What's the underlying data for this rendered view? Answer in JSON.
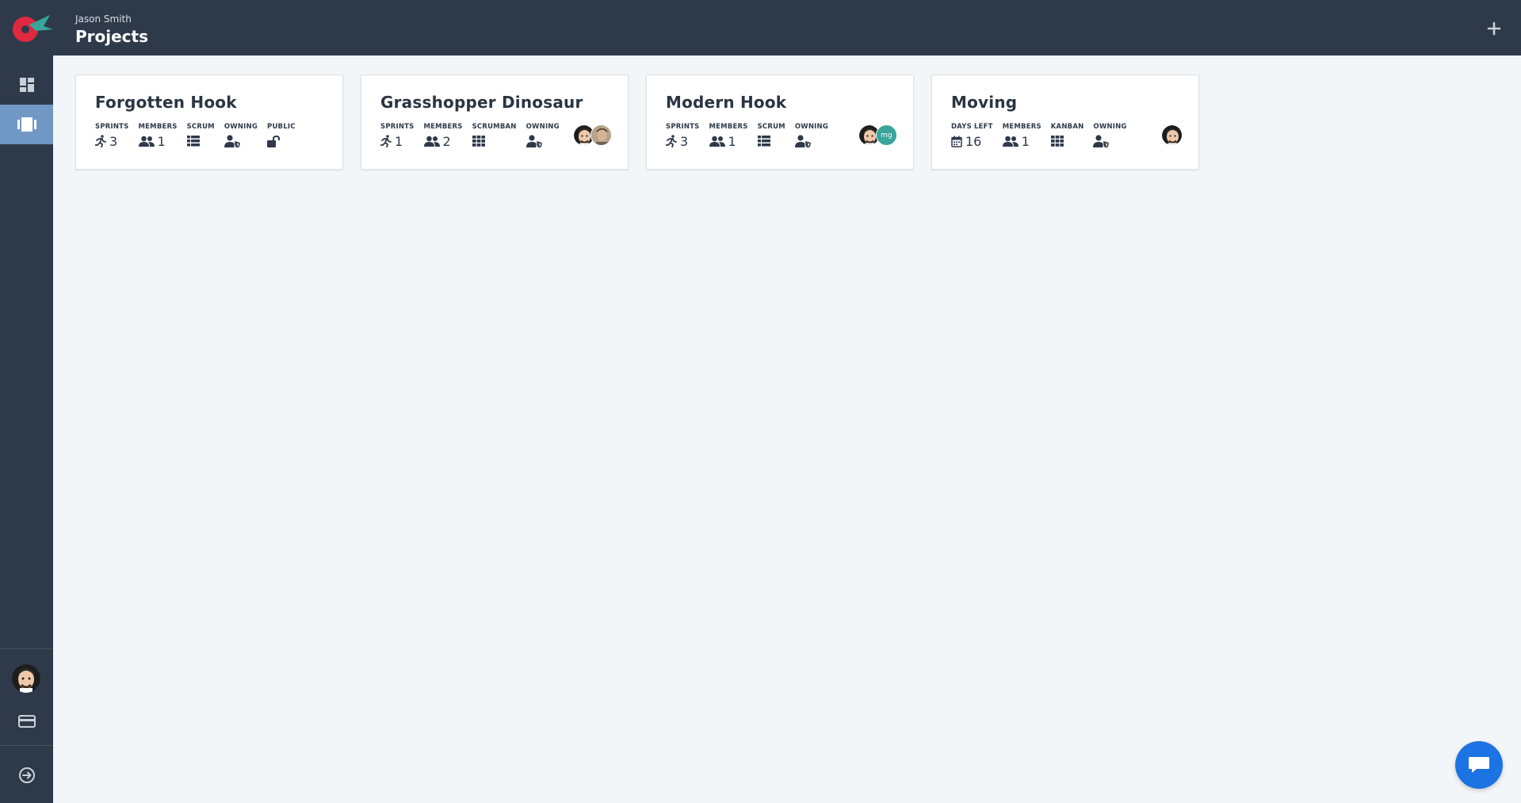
{
  "header": {
    "user_name": "Jason Smith",
    "title": "Projects",
    "add_icon": "plus-icon"
  },
  "sidebar": {
    "items": [
      {
        "name": "dashboard",
        "icon": "dashboard-icon",
        "active": false
      },
      {
        "name": "projects",
        "icon": "board-icon",
        "active": true
      }
    ],
    "bottom": [
      {
        "name": "profile",
        "icon": "avatar"
      },
      {
        "name": "billing",
        "icon": "credit-card-icon"
      },
      {
        "name": "logout",
        "icon": "logout-icon"
      }
    ]
  },
  "projects": [
    {
      "title": "Forgotten Hook",
      "stats": [
        {
          "label": "SPRINTS",
          "icon": "running-icon",
          "value": "3"
        },
        {
          "label": "MEMBERS",
          "icon": "users-icon",
          "value": "1"
        },
        {
          "label": "SCRUM",
          "icon": "list-icon",
          "value": ""
        },
        {
          "label": "OWNING",
          "icon": "user-shield-icon",
          "value": ""
        },
        {
          "label": "PUBLIC",
          "icon": "unlock-icon",
          "value": ""
        }
      ],
      "avatars": []
    },
    {
      "title": "Grasshopper Dinosaur",
      "stats": [
        {
          "label": "SPRINTS",
          "icon": "running-icon",
          "value": "1"
        },
        {
          "label": "MEMBERS",
          "icon": "users-icon",
          "value": "2"
        },
        {
          "label": "SCRUMBAN",
          "icon": "grid-icon",
          "value": ""
        },
        {
          "label": "OWNING",
          "icon": "user-shield-icon",
          "value": ""
        }
      ],
      "avatars": [
        "avatar-a",
        "avatar-b"
      ]
    },
    {
      "title": "Modern Hook",
      "stats": [
        {
          "label": "SPRINTS",
          "icon": "running-icon",
          "value": "3"
        },
        {
          "label": "MEMBERS",
          "icon": "users-icon",
          "value": "1"
        },
        {
          "label": "SCRUM",
          "icon": "list-icon",
          "value": ""
        },
        {
          "label": "OWNING",
          "icon": "user-shield-icon",
          "value": ""
        }
      ],
      "avatars": [
        "avatar-a",
        "mg"
      ]
    },
    {
      "title": "Moving",
      "stats": [
        {
          "label": "DAYS LEFT",
          "icon": "calendar-icon",
          "value": "16"
        },
        {
          "label": "MEMBERS",
          "icon": "users-icon",
          "value": "1"
        },
        {
          "label": "KANBAN",
          "icon": "grid-icon",
          "value": ""
        },
        {
          "label": "OWNING",
          "icon": "user-shield-icon",
          "value": ""
        }
      ],
      "avatars": [
        "avatar-a"
      ]
    }
  ],
  "colors": {
    "header_bg": "#2e3a4a",
    "active_nav": "#6f98c5",
    "page_bg": "#f3f6f8",
    "chat_button": "#1c73e3",
    "logo_red": "#e0283f",
    "logo_teal": "#3aa59b"
  },
  "chat": {
    "icon": "chat-bubble-icon"
  }
}
